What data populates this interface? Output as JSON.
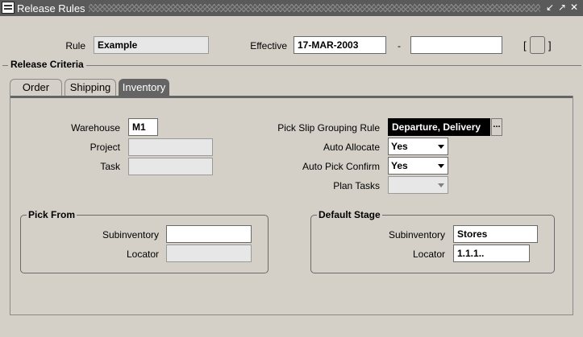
{
  "window": {
    "title": "Release Rules"
  },
  "header": {
    "rule_label": "Rule",
    "rule_value": "Example",
    "effective_label": "Effective",
    "effective_from": "17-MAR-2003",
    "dash": "-",
    "effective_to": "",
    "bracket_open": "[",
    "bracket_close": "]"
  },
  "release_criteria": {
    "title": "Release Criteria",
    "tabs": [
      {
        "label": "Order",
        "active": false
      },
      {
        "label": "Shipping",
        "active": false
      },
      {
        "label": "Inventory",
        "active": true
      }
    ]
  },
  "inventory": {
    "warehouse_label": "Warehouse",
    "warehouse_value": "M1",
    "project_label": "Project",
    "project_value": "",
    "task_label": "Task",
    "task_value": "",
    "pick_slip_label": "Pick Slip Grouping Rule",
    "pick_slip_value": "Departure, Delivery",
    "lov_glyph": "...",
    "auto_allocate_label": "Auto Allocate",
    "auto_allocate_value": "Yes",
    "auto_pick_confirm_label": "Auto Pick Confirm",
    "auto_pick_confirm_value": "Yes",
    "plan_tasks_label": "Plan Tasks",
    "plan_tasks_value": ""
  },
  "pick_from": {
    "title": "Pick From",
    "subinventory_label": "Subinventory",
    "subinventory_value": "",
    "locator_label": "Locator",
    "locator_value": ""
  },
  "default_stage": {
    "title": "Default Stage",
    "subinventory_label": "Subinventory",
    "subinventory_value": "Stores",
    "locator_label": "Locator",
    "locator_value": "1.1.1.."
  }
}
